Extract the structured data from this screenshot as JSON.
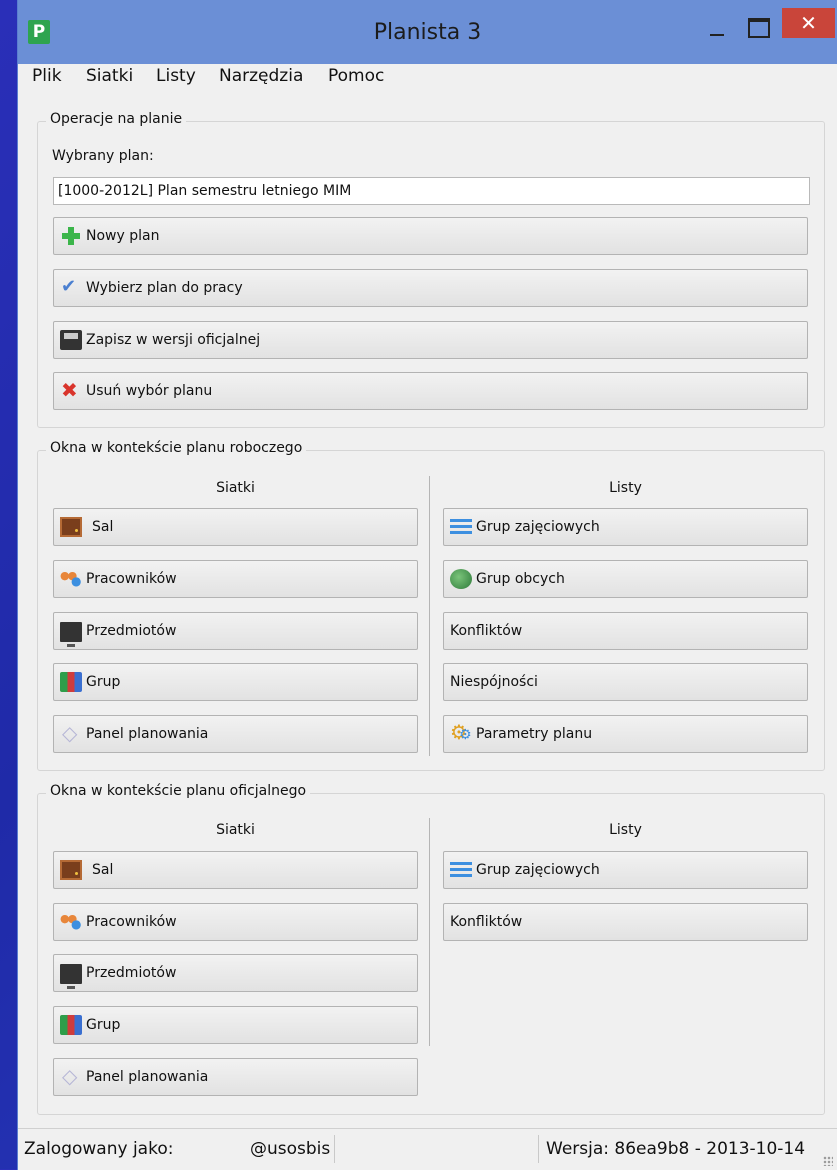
{
  "window": {
    "title": "Planista 3",
    "app_icon_letter": "P"
  },
  "menu": [
    "Plik",
    "Siatki",
    "Listy",
    "Narzędzia",
    "Pomoc"
  ],
  "operations": {
    "legend": "Operacje na planie",
    "selected_label": "Wybrany plan:",
    "selected_value": "[1000-2012L] Plan semestru letniego MIM",
    "buttons": [
      {
        "label": "Nowy plan",
        "icon": "plus-icon"
      },
      {
        "label": "Wybierz plan do pracy",
        "icon": "check-icon"
      },
      {
        "label": "Zapisz w wersji oficjalnej",
        "icon": "save-icon"
      },
      {
        "label": "Usuń wybór planu",
        "icon": "delete-icon"
      }
    ]
  },
  "working": {
    "legend": "Okna w kontekście planu roboczego",
    "grids_head": "Siatki",
    "lists_head": "Listy",
    "grids": [
      "Sal",
      "Pracowników",
      "Przedmiotów",
      "Grup",
      "Panel planowania"
    ],
    "lists": [
      "Grup zajęciowych",
      "Grup obcych",
      "Konfliktów",
      "Niespójności",
      "Parametry planu"
    ]
  },
  "official": {
    "legend": "Okna w kontekście planu oficjalnego",
    "grids_head": "Siatki",
    "lists_head": "Listy",
    "grids": [
      "Sal",
      "Pracowników",
      "Przedmiotów",
      "Grup",
      "Panel planowania"
    ],
    "lists": [
      "Grup zajęciowych",
      "Konfliktów"
    ]
  },
  "status": {
    "logged_label": "Zalogowany jako:",
    "logged_domain": "@usosbis",
    "version": "Wersja: 86ea9b8 - 2013-10-14"
  },
  "colors": {
    "titlebar": "#6b8fd6",
    "close_button": "#c9453a",
    "desktop": "#2a2fb8"
  }
}
